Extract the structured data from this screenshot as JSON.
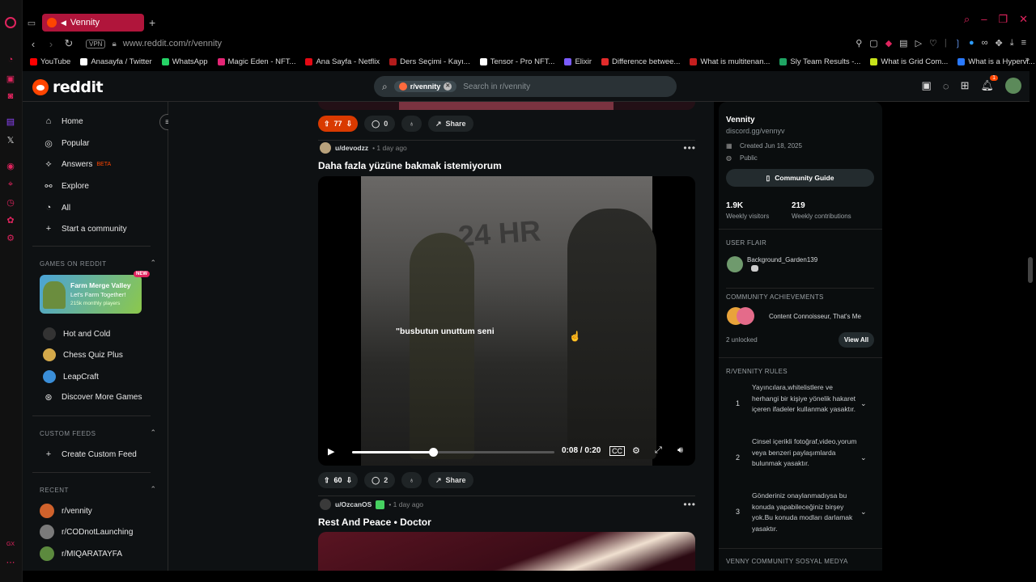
{
  "browser": {
    "tab_title": "Vennity",
    "url": "www.reddit.com/r/vennity",
    "vpn_label": "VPN",
    "bookmarks": [
      {
        "label": "YouTube",
        "color": "#ff0000"
      },
      {
        "label": "Anasayfa / Twitter",
        "color": "#ffffff"
      },
      {
        "label": "WhatsApp",
        "color": "#25d366"
      },
      {
        "label": "Magic Eden - NFT...",
        "color": "#e42575"
      },
      {
        "label": "Ana Sayfa - Netflix",
        "color": "#e50914"
      },
      {
        "label": "Ders Seçimi - Kayı...",
        "color": "#b31b1b"
      },
      {
        "label": "Tensor - Pro NFT...",
        "color": "#ffffff"
      },
      {
        "label": "Elixir",
        "color": "#7b5cff"
      },
      {
        "label": "Difference betwee...",
        "color": "#e32b2b"
      },
      {
        "label": "What is multitenan...",
        "color": "#c41e1e"
      },
      {
        "label": "Sly Team Results -...",
        "color": "#1fa463"
      },
      {
        "label": "What is Grid Com...",
        "color": "#c7e21a"
      },
      {
        "label": "What is a Hypervi...",
        "color": "#2979ff"
      }
    ]
  },
  "header": {
    "logo_text": "reddit",
    "search_chip": "r/vennity",
    "search_placeholder": "Search in r/vennity",
    "notification_count": "1"
  },
  "left_sidebar": {
    "nav": [
      {
        "label": "Home",
        "icon": "home-icon"
      },
      {
        "label": "Popular",
        "icon": "popular-icon"
      },
      {
        "label": "Answers",
        "icon": "answers-icon",
        "badge": "BETA"
      },
      {
        "label": "Explore",
        "icon": "explore-icon"
      },
      {
        "label": "All",
        "icon": "all-icon"
      },
      {
        "label": "Start a community",
        "icon": "plus-icon"
      }
    ],
    "games_label": "GAMES ON REDDIT",
    "featured_game": {
      "title": "Farm Merge Valley",
      "subtitle": "Let's Farm Together!",
      "meta": "215k monthly players",
      "badge": "NEW"
    },
    "games": [
      "Hot and Cold",
      "Chess Quiz Plus",
      "LeapCraft",
      "Discover More Games"
    ],
    "custom_feeds_label": "CUSTOM FEEDS",
    "create_feed": "Create Custom Feed",
    "recent_label": "RECENT",
    "recent": [
      "r/vennity",
      "r/CODnotLaunching",
      "r/MIQARATAYFA"
    ]
  },
  "feed": {
    "post0": {
      "votes": "77",
      "comments": "0",
      "share": "Share"
    },
    "post1": {
      "user": "u/devodzz",
      "time": "• 1 day ago",
      "title": "Daha fazla yüzüne bakmak istemiyorum",
      "subtitle_text": "\"busbutun unuttum seni",
      "video_time": "0:08 / 0:20",
      "progress": 0.4,
      "votes": "60",
      "comments": "2",
      "share": "Share"
    },
    "post2": {
      "user": "u/OzcanOS",
      "time": "• 1 day ago",
      "title": "Rest And Peace • Doctor"
    }
  },
  "right_sidebar": {
    "name": "Vennity",
    "link": "discord.gg/vennyv",
    "created": "Created Jun 18, 2025",
    "visibility": "Public",
    "guide_button": "Community Guide",
    "weekly_visitors": "1.9K",
    "weekly_visitors_label": "Weekly visitors",
    "weekly_contrib": "219",
    "weekly_contrib_label": "Weekly contributions",
    "user_flair_label": "USER FLAIR",
    "flair_user": "Background_Garden139",
    "achievements_label": "COMMUNITY ACHIEVEMENTS",
    "achievements_text": "Content Connoisseur, That's Me",
    "unlocked": "2 unlocked",
    "view_all": "View All",
    "rules_label": "R/VENNITY RULES",
    "rules": [
      {
        "n": "1",
        "text": "Yayıncılara,whitelistlere ve herhangi bir kişiye yönelik hakaret içeren ifadeler kullanmak yasaktır."
      },
      {
        "n": "2",
        "text": "Cinsel içerikli fotoğraf,video,yorum veya benzeri paylaşımlarda bulunmak yasaktır."
      },
      {
        "n": "3",
        "text": "Gönderiniz onaylanmadıysa bu konuda yapabileceğiniz birşey yok.Bu konuda modları darlamak yasaktır."
      }
    ],
    "social_label": "VENNY COMMUNITY SOSYAL MEDYA"
  }
}
